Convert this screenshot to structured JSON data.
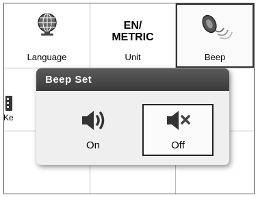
{
  "menu": {
    "language_label": "Language",
    "unit_title_line1": "EN/",
    "unit_title_line2": "METRIC",
    "unit_label": "Unit",
    "beep_label": "Beep",
    "partial_label": "Ke"
  },
  "popup": {
    "title": "Beep Set",
    "on_label": "On",
    "off_label": "Off",
    "selected": "Off"
  },
  "icons": {
    "language": "globe-icon",
    "beep": "speaker-beep-icon",
    "keyboard": "keyboard-icon",
    "on": "speaker-on-icon",
    "off": "speaker-mute-icon"
  }
}
